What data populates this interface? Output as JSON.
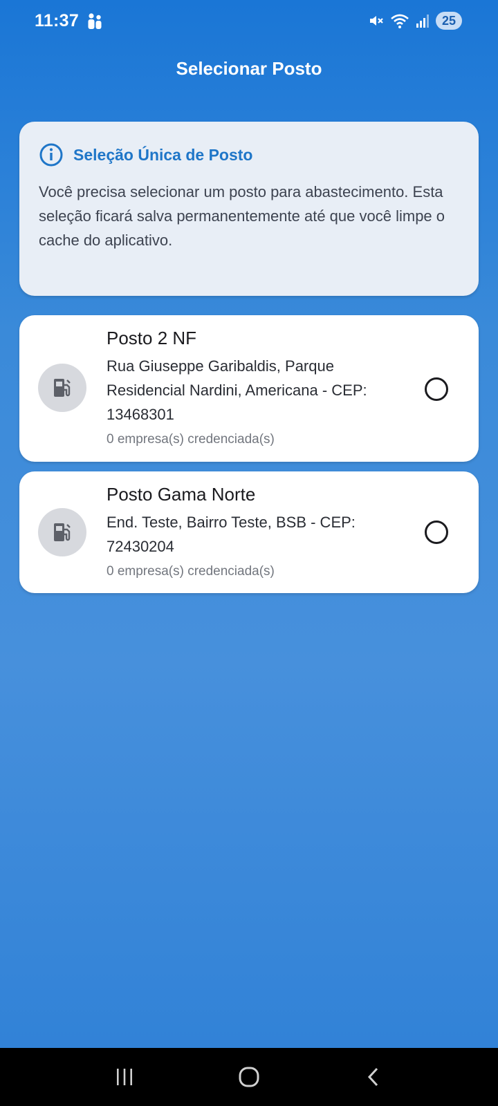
{
  "status_bar": {
    "time": "11:37",
    "battery": "25",
    "icons": [
      "people-icon",
      "mute-icon",
      "wifi-icon",
      "signal-icon"
    ]
  },
  "app_bar": {
    "title": "Selecionar Posto"
  },
  "info_card": {
    "title": "Seleção Única de Posto",
    "text": "Você precisa selecionar um posto para abastecimento. Esta seleção ficará salva permanentemente até que você limpe o cache do aplicativo.",
    "icon": "info-icon"
  },
  "stations": [
    {
      "name": "Posto 2 NF",
      "address": "Rua Giuseppe Garibaldis, Parque Residencial Nardini, Americana - CEP: 13468301",
      "companies": "0 empresa(s) credenciada(s)",
      "icon": "fuel-pump-icon",
      "selected": false
    },
    {
      "name": "Posto Gama Norte",
      "address": "End. Teste, Bairro Teste, BSB - CEP: 72430204",
      "companies": "0 empresa(s) credenciada(s)",
      "icon": "fuel-pump-icon",
      "selected": false
    }
  ],
  "colors": {
    "accent": "#1f76c8",
    "background_top": "#1a76d6",
    "info_card_bg": "#e8eef6",
    "icon_circle_bg": "#d7d9de"
  },
  "nav_bar": {
    "buttons": [
      "recent-apps-icon",
      "home-icon",
      "back-icon"
    ]
  }
}
